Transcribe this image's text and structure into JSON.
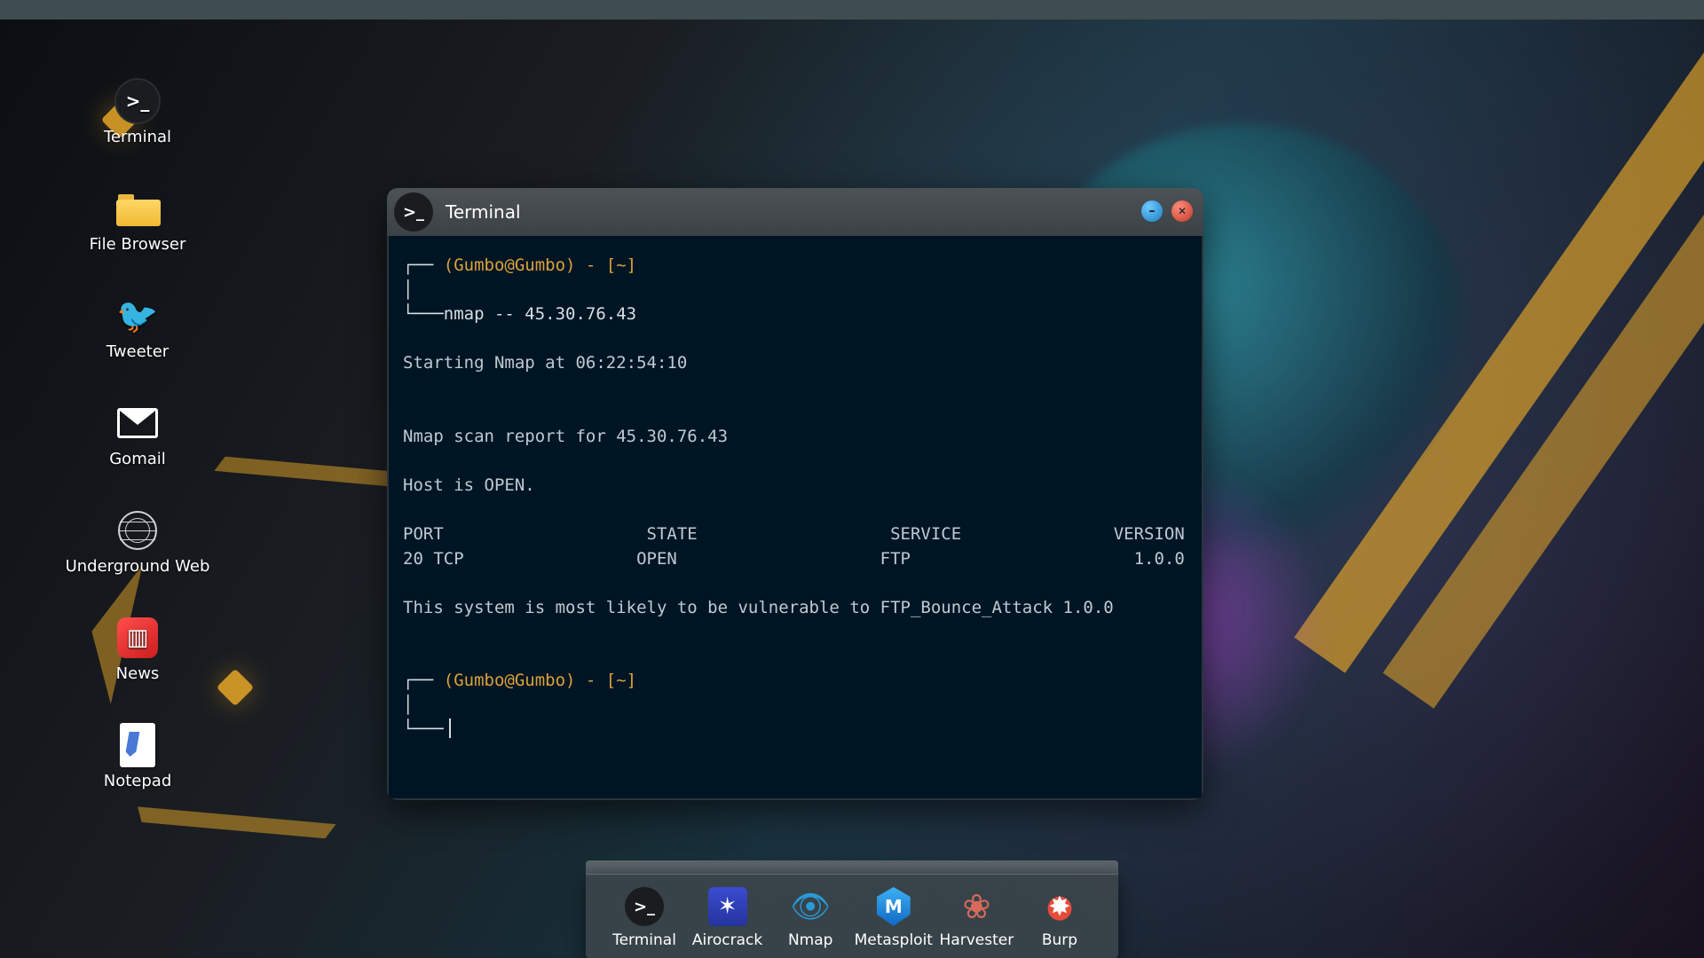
{
  "desktop_icons": [
    {
      "name": "terminal",
      "label": "Terminal"
    },
    {
      "name": "file-browser",
      "label": "File Browser"
    },
    {
      "name": "tweeter",
      "label": "Tweeter"
    },
    {
      "name": "gomail",
      "label": "Gomail"
    },
    {
      "name": "underground-web",
      "label": "Underground Web"
    },
    {
      "name": "news",
      "label": "News"
    },
    {
      "name": "notepad",
      "label": "Notepad"
    }
  ],
  "window": {
    "title": "Terminal",
    "prompt_user": "(Gumbo@Gumbo) - [~]",
    "command": "nmap -- 45.30.76.43",
    "out_start": "Starting Nmap at 06:22:54:10",
    "out_report": "Nmap scan report for 45.30.76.43",
    "out_host": "Host is OPEN.",
    "out_header": "PORT                    STATE                   SERVICE               VERSION",
    "out_row": "20 TCP                 OPEN                    FTP                      1.0.0",
    "out_vuln": "This system is most likely to be vulnerable to FTP_Bounce_Attack 1.0.0"
  },
  "dock": [
    {
      "name": "terminal",
      "label": "Terminal"
    },
    {
      "name": "airocrack",
      "label": "Airocrack"
    },
    {
      "name": "nmap",
      "label": "Nmap"
    },
    {
      "name": "metasploit",
      "label": "Metasploit"
    },
    {
      "name": "harvester",
      "label": "Harvester"
    },
    {
      "name": "burp",
      "label": "Burp"
    }
  ]
}
